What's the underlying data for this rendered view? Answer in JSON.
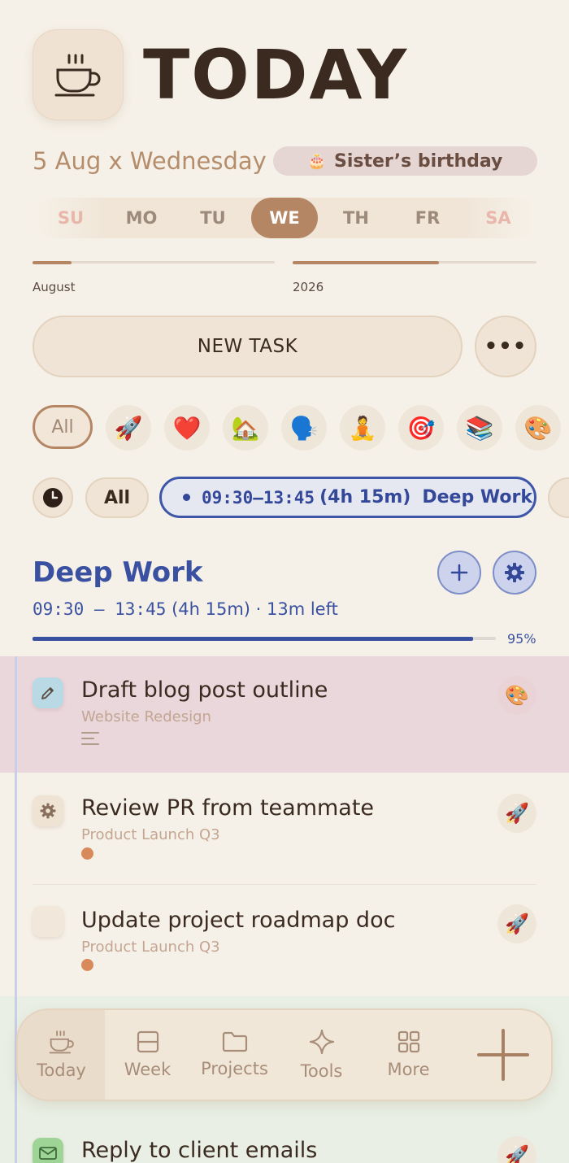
{
  "header": {
    "title": "TODAY",
    "icon": "coffee-cup-icon",
    "date_line": "5 Aug x Wednesday",
    "event": {
      "icon": "cake-icon",
      "emoji": "🎂",
      "label": "Sister’s birthday"
    }
  },
  "week": {
    "days": [
      "SU",
      "MO",
      "TU",
      "WE",
      "TH",
      "FR",
      "SA"
    ],
    "active_index": 3
  },
  "progress_tracks": [
    {
      "label": "August",
      "fraction": 0.16
    },
    {
      "label": "2026",
      "fraction": 0.6
    }
  ],
  "actions": {
    "new_task_label": "NEW TASK",
    "more_label": "•••"
  },
  "categories": {
    "all_label": "All",
    "items": [
      {
        "name": "rocket-icon",
        "emoji": "🚀"
      },
      {
        "name": "heart-icon",
        "emoji": "❤️"
      },
      {
        "name": "house-icon",
        "emoji": "🏡"
      },
      {
        "name": "speaking-head-icon",
        "emoji": "🗣️"
      },
      {
        "name": "yoga-icon",
        "emoji": "🧘"
      },
      {
        "name": "target-icon",
        "emoji": "🎯"
      },
      {
        "name": "books-icon",
        "emoji": "📚"
      },
      {
        "name": "palette-icon",
        "emoji": "🎨"
      }
    ]
  },
  "time_filter": {
    "all_label": "All",
    "active_block": {
      "time": "09:30–13:45",
      "duration": "(4h 15m)",
      "name": "Deep Work"
    }
  },
  "section": {
    "title": "Deep Work",
    "time": "09:30 — 13:45",
    "detail": "(4h 15m) · 13m left",
    "progress_fraction": 0.95,
    "progress_label": "95%"
  },
  "tasks": [
    {
      "title": "Draft blog post outline",
      "project": "Website Redesign",
      "check_icon": "pencil-icon",
      "tag_emoji": "🎨",
      "tag_icon": "palette-icon"
    },
    {
      "title": "Review PR from teammate",
      "project": "Product Launch Q3",
      "check_icon": "gear-icon",
      "tag_emoji": "🚀",
      "tag_icon": "rocket-icon"
    },
    {
      "title": "Update project roadmap doc",
      "project": "Product Launch Q3",
      "check_icon": "",
      "tag_emoji": "🚀",
      "tag_icon": "rocket-icon"
    },
    {
      "title": "Reply to client emails",
      "project": "",
      "check_icon": "mail-icon",
      "tag_emoji": "🚀",
      "tag_icon": "rocket-icon"
    }
  ],
  "nav": {
    "items": [
      {
        "label": "Today",
        "icon": "coffee-cup-icon"
      },
      {
        "label": "Week",
        "icon": "week-grid-icon"
      },
      {
        "label": "Projects",
        "icon": "folder-icon"
      },
      {
        "label": "Tools",
        "icon": "sparkle-icon"
      },
      {
        "label": "More",
        "icon": "apps-grid-icon"
      }
    ],
    "active_index": 0,
    "add_icon": "plus-icon"
  },
  "colors": {
    "background": "#f6f1e8",
    "accent": "#b48663",
    "block_blue": "#3a51a2",
    "priority": "#d98a5a"
  }
}
